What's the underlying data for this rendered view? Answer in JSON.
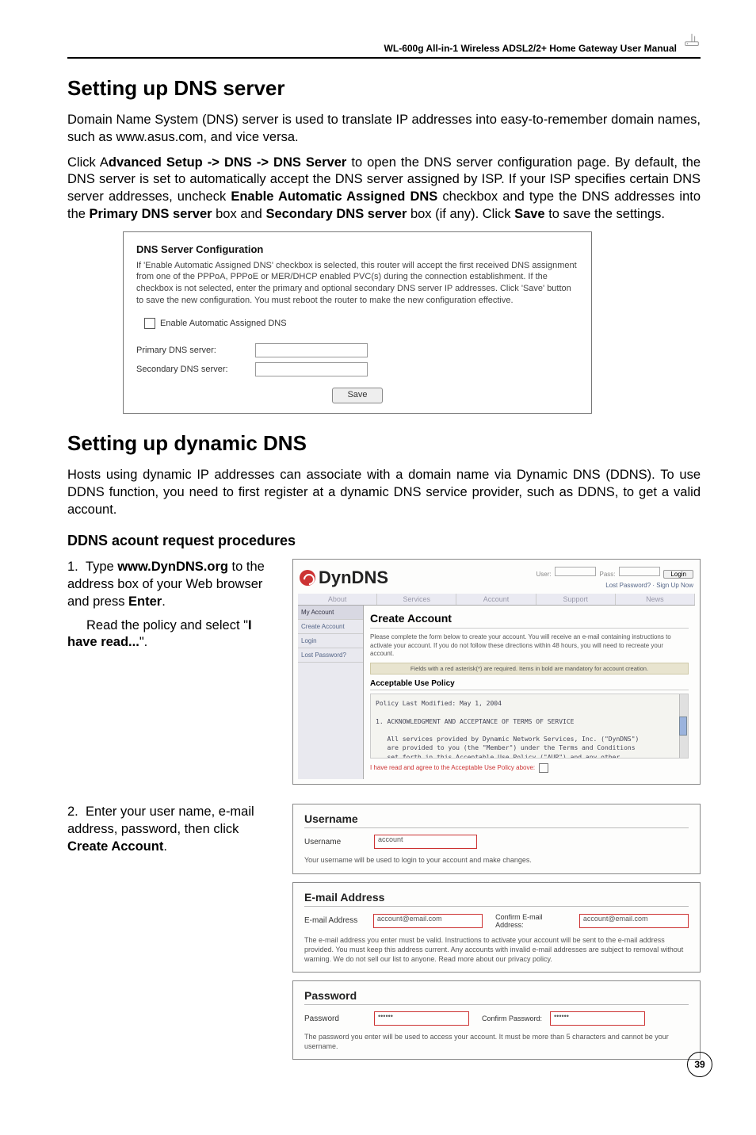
{
  "header": {
    "manual_title": "WL-600g All-in-1 Wireless ADSL2/2+ Home Gateway User Manual"
  },
  "s1": {
    "title": "Setting up DNS server",
    "p1": "Domain Name System (DNS) server is used to translate IP addresses into easy-to-remember domain names, such as www.asus.com, and vice versa.",
    "p2_pre": "Click A",
    "p2_b1": "dvanced Setup -> DNS -> DNS Server",
    "p2_mid1": " to open the DNS server configuration page. By default, the DNS server is set to automatically accept the DNS server assigned by ISP. If your ISP specifies certain DNS server addresses, uncheck ",
    "p2_b2": "Enable Automatic Assigned DNS",
    "p2_mid2": " checkbox and type the DNS addresses into the ",
    "p2_b3": "Primary DNS server",
    "p2_mid3": " box and ",
    "p2_b4": "Secondary DNS server",
    "p2_mid4": " box (if any). Click ",
    "p2_b5": "Save",
    "p2_end": " to save the settings."
  },
  "dns_panel": {
    "title": "DNS Server Configuration",
    "desc": "If 'Enable Automatic Assigned DNS' checkbox is selected, this router will accept the first received DNS assignment from one of the PPPoA, PPPoE or MER/DHCP enabled PVC(s) during the connection establishment. If the checkbox is not selected, enter the primary and optional secondary DNS server IP addresses. Click 'Save' button to save the new configuration. You must reboot the router to make the new configuration effective.",
    "cb_label": "Enable Automatic Assigned DNS",
    "primary_label": "Primary DNS server:",
    "secondary_label": "Secondary DNS server:",
    "save_btn": "Save"
  },
  "s2": {
    "title": "Setting up dynamic DNS",
    "p1": "Hosts using dynamic IP addresses can associate with a domain name via Dynamic DNS (DDNS). To use DDNS function, you need to first register at a dynamic DNS service provider, such as DDNS, to get a valid account.",
    "sub": "DDNS acount request procedures"
  },
  "step1": {
    "line_a": "Type ",
    "url": "www.DynDNS.org",
    "line_b": " to the address box of your Web browser and press ",
    "enter": "Enter",
    "dot": ".",
    "line_c": "Read the policy and select \"",
    "have_read": "I have read...",
    "quote_end": "\"."
  },
  "dyn": {
    "logo": "DynDNS",
    "login_btn": "Login",
    "top_link": "Lost Password? · Sign Up Now",
    "tabs": [
      "About",
      "Services",
      "Account",
      "Support",
      "News"
    ],
    "side": [
      "My Account",
      "Create Account",
      "Login",
      "Lost Password?"
    ],
    "main_title": "Create Account",
    "intro": "Please complete the form below to create your account. You will receive an e-mail containing instructions to activate your account. If you do not follow these directions within 48 hours, you will need to recreate your account.",
    "bar": "Fields with a red asterisk(*) are required. Items in bold are mandatory for account creation.",
    "aup_title": "Acceptable Use Policy",
    "aup_body": "Policy Last Modified: May 1, 2004\n\n1. ACKNOWLEDGMENT AND ACCEPTANCE OF TERMS OF SERVICE\n\n   All services provided by Dynamic Network Services, Inc. (\"DynDNS\")\n   are provided to you (the \"Member\") under the Terms and Conditions\n   set forth in this Acceptable Use Policy (\"AUP\") and any other\n   operating rules and policies set forth by DynDNS. The AUP comprises",
    "agree_text": "I have read and agree to the Acceptable Use Policy above:"
  },
  "step2": {
    "line_a": "Enter your user name, e-mail address, password, then click ",
    "create": "Create Account",
    "dot": "."
  },
  "acc_user": {
    "h": "Username",
    "label": "Username",
    "value": "account",
    "note": "Your username will be used to login to your account and make changes."
  },
  "acc_email": {
    "h": "E-mail Address",
    "label1": "E-mail Address",
    "value1": "account@email.com",
    "label2": "Confirm E-mail Address:",
    "value2": "account@email.com",
    "note": "The e-mail address you enter must be valid. Instructions to activate your account will be sent to the e-mail address provided. You must keep this address current. Any accounts with invalid e-mail addresses are subject to removal without warning. We do not sell our list to anyone. Read more about our privacy policy."
  },
  "acc_pw": {
    "h": "Password",
    "label1": "Password",
    "value1": "••••••",
    "label2": "Confirm Password:",
    "value2": "••••••",
    "note": "The password you enter will be used to access your account. It must be more than 5 characters and cannot be your username."
  },
  "page_number": "39"
}
